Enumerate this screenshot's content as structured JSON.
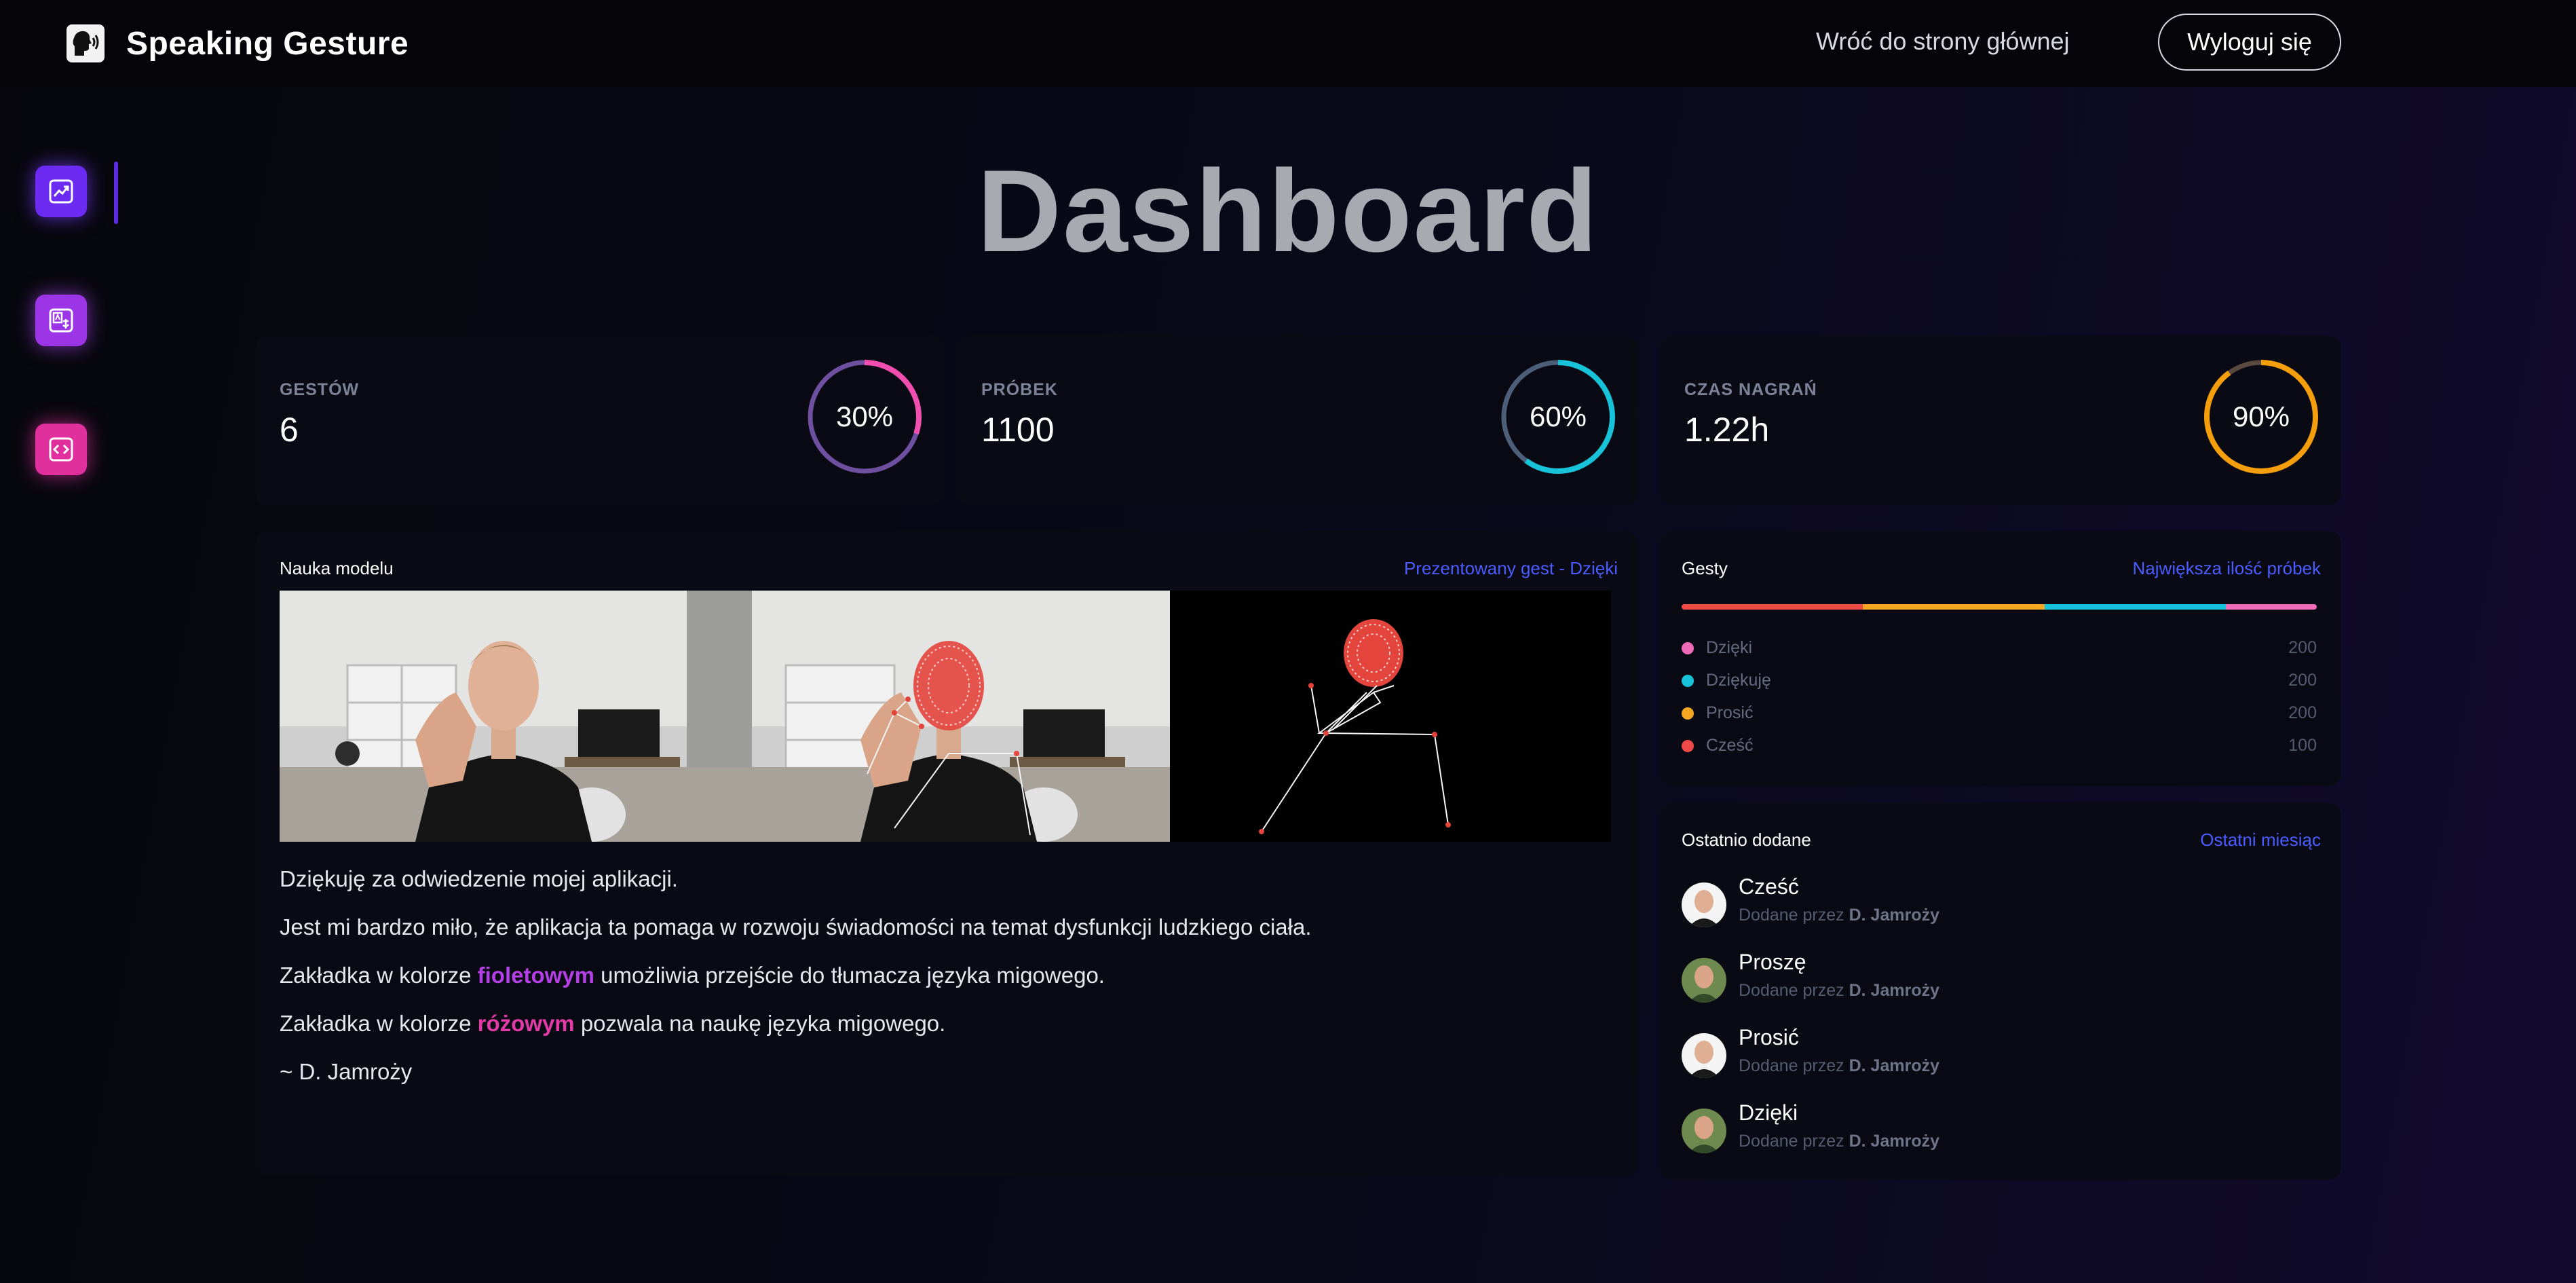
{
  "brand": {
    "name": "Speaking Gesture"
  },
  "nav": {
    "home": "Wróć do strony głównej",
    "logout": "Wyloguj się"
  },
  "page": {
    "title": "Dashboard"
  },
  "stats": [
    {
      "label": "GESTÓW",
      "value": "6",
      "percent": "30%",
      "fraction": 0.3,
      "color": "#f04fb0"
    },
    {
      "label": "PRÓBEK",
      "value": "1100",
      "percent": "60%",
      "fraction": 0.6,
      "color": "#16c3d9"
    },
    {
      "label": "CZAS NAGRAŃ",
      "value": "1.22h",
      "percent": "90%",
      "fraction": 0.9,
      "color": "#f59e0b"
    }
  ],
  "model": {
    "title": "Nauka modelu",
    "link": "Prezentowany gest - Dzięki",
    "messages": {
      "line1": "Dziękuję za odwiedzenie mojej aplikacji.",
      "line2": "Jest mi bardzo miło, że aplikacja ta pomaga w rozwoju świadomości na temat dysfunkcji ludzkiego ciała.",
      "line3_pre": "Zakładka w kolorze ",
      "line3_hl": "fioletowym",
      "line3_post": " umożliwia przejście do tłumacza języka migowego.",
      "line4_pre": "Zakładka w kolorze ",
      "line4_hl": "różowym",
      "line4_post": " pozwala na naukę języka migowego.",
      "signature": "~ D. Jamroży"
    }
  },
  "gestures": {
    "title": "Gesty",
    "link": "Największa ilość próbek",
    "items": [
      {
        "name": "Dzięki",
        "value": "200",
        "color": "#f06ab8"
      },
      {
        "name": "Dziękuję",
        "value": "200",
        "color": "#16c3d9"
      },
      {
        "name": "Prosić",
        "value": "200",
        "color": "#f5a623"
      },
      {
        "name": "Cześć",
        "value": "100",
        "color": "#f04a48"
      }
    ],
    "bar_colors": [
      "#f04a48",
      "#f5a623",
      "#16c3d9",
      "#f06ab8"
    ]
  },
  "recent": {
    "title": "Ostatnio dodane",
    "link": "Ostatni miesiąc",
    "prefix": "Dodane przez ",
    "items": [
      {
        "title": "Cześć",
        "author": "D. Jamroży"
      },
      {
        "title": "Proszę",
        "author": "D. Jamroży"
      },
      {
        "title": "Prosić",
        "author": "D. Jamroży"
      },
      {
        "title": "Dzięki",
        "author": "D. Jamroży"
      }
    ]
  }
}
